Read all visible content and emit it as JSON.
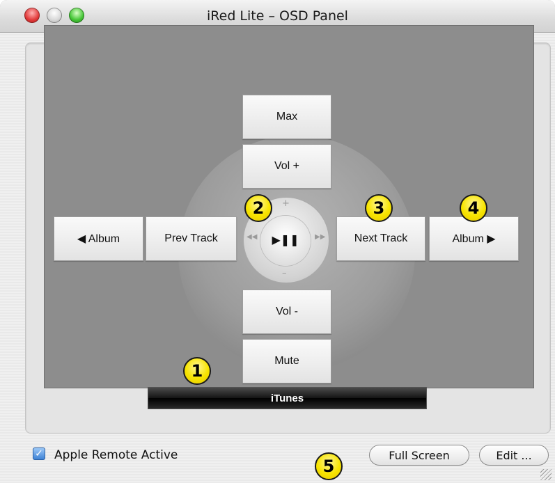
{
  "window": {
    "title": "iRed Lite – OSD Panel"
  },
  "remote": {
    "buttons": {
      "max": "Max",
      "vol_up": "Vol +",
      "vol_down": "Vol -",
      "mute": "Mute",
      "album_prev": "◀ Album",
      "prev_track": "Prev Track",
      "next_track": "Next Track",
      "album_next": "Album ▶"
    },
    "play_pause": "▶❚❚",
    "app_name": "iTunes"
  },
  "callouts": [
    "1",
    "2",
    "3",
    "4",
    "5"
  ],
  "footer": {
    "apple_remote_label": "Apple Remote Active",
    "apple_remote_checked": true,
    "full_screen": "Full Screen",
    "edit": "Edit ..."
  },
  "colors": {
    "panel_bg": "#8d8d8d",
    "badge_yellow": "#f7e400",
    "checkbox_blue": "#3e82d6"
  }
}
